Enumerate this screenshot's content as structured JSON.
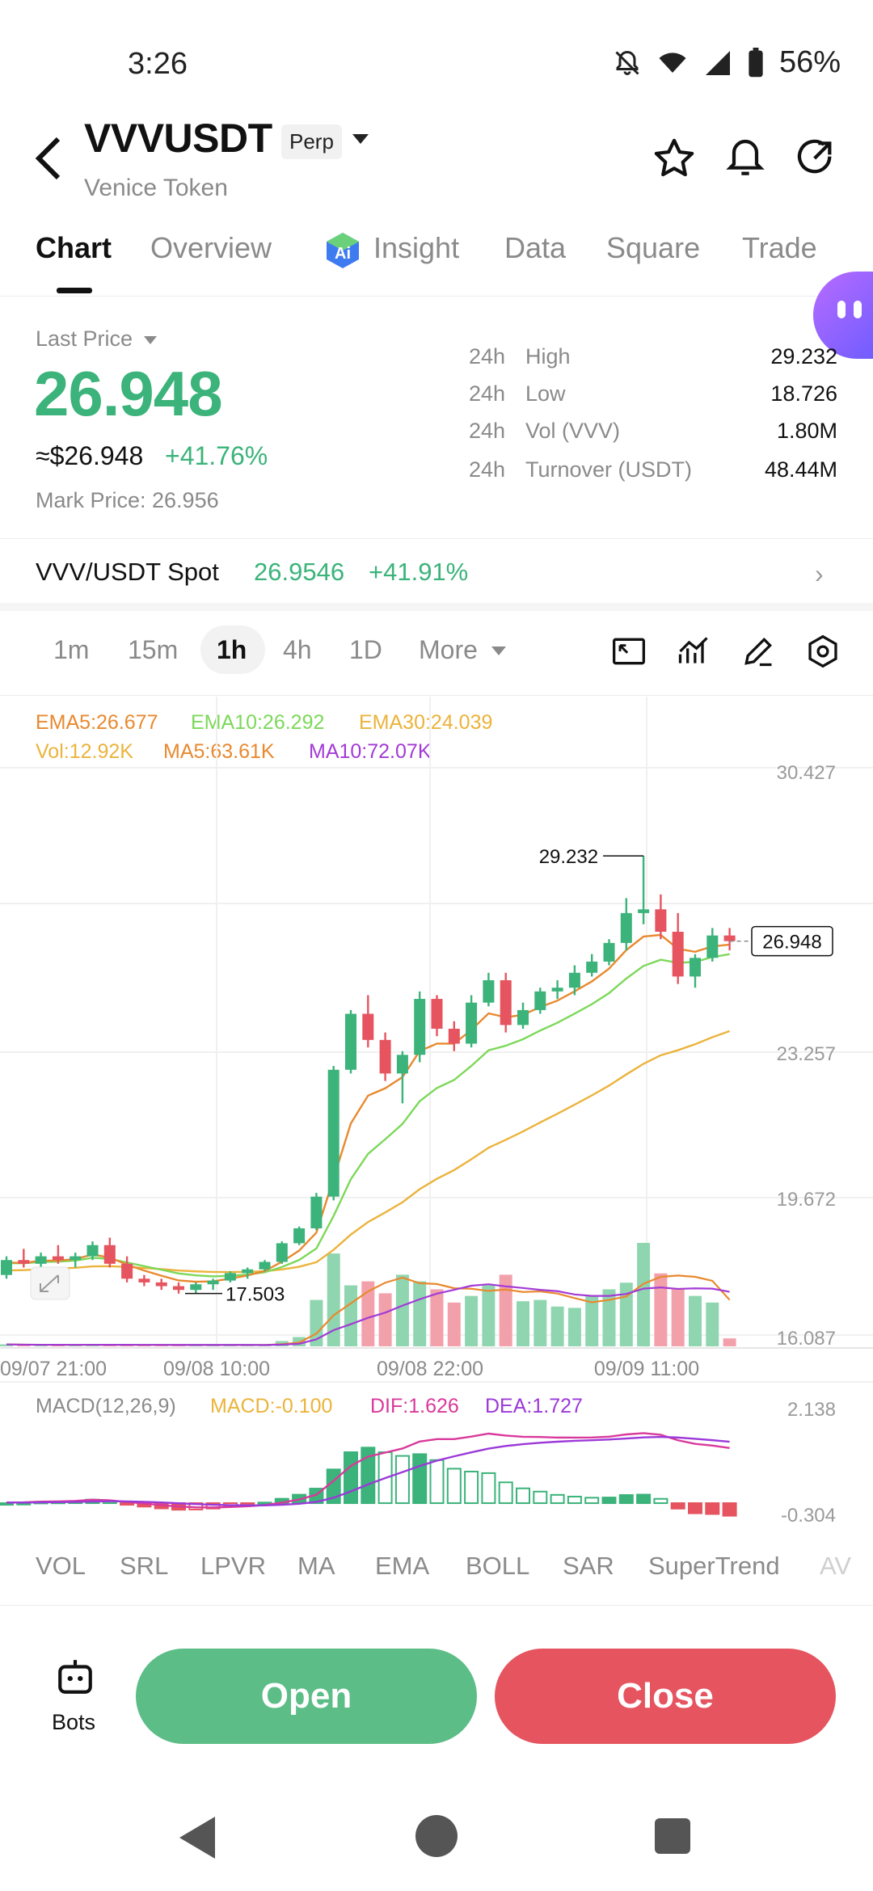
{
  "status": {
    "time": "3:26",
    "battery": "56%"
  },
  "header": {
    "symbol": "VVVUSDT",
    "badge": "Perp",
    "subtitle": "Venice Token"
  },
  "tabs": [
    "Chart",
    "Overview",
    "Insight",
    "Data",
    "Square",
    "Trade"
  ],
  "price": {
    "last_price_label": "Last Price",
    "last_price": "26.948",
    "usd_price": "≈$26.948",
    "change_pct": "+41.76%",
    "mark_price": "Mark Price: 26.956"
  },
  "stats": [
    {
      "period": "24h",
      "name": "High",
      "value": "29.232"
    },
    {
      "period": "24h",
      "name": "Low",
      "value": "18.726"
    },
    {
      "period": "24h",
      "name": "Vol (VVV)",
      "value": "1.80M"
    },
    {
      "period": "24h",
      "name": "Turnover (USDT)",
      "value": "48.44M"
    }
  ],
  "spot": {
    "label": "VVV/USDT Spot",
    "price": "26.9546",
    "change": "+41.91%"
  },
  "intervals": [
    "1m",
    "15m",
    "1h",
    "4h",
    "1D",
    "More"
  ],
  "legend": {
    "ema5": "EMA5:26.677",
    "ema10": "EMA10:26.292",
    "ema30": "EMA30:24.039",
    "vol": "Vol:12.92K",
    "ma5": "MA5:63.61K",
    "ma10": "MA10:72.07K"
  },
  "macd_legend": {
    "name": "MACD(12,26,9)",
    "macd": "MACD:-0.100",
    "dif": "DIF:1.626",
    "dea": "DEA:1.727"
  },
  "colors": {
    "up": "#3bb37a",
    "down": "#e5545f",
    "ema5": "#e8892f",
    "ema10": "#7cd85a",
    "ema30": "#ebb33b",
    "ma10": "#a33ad6",
    "dif": "#d9399b",
    "dea": "#9b39d9"
  },
  "indicators": [
    "VOL",
    "SRL",
    "LPVR",
    "MA",
    "EMA",
    "BOLL",
    "SAR",
    "SuperTrend",
    "AV"
  ],
  "actions": {
    "bots": "Bots",
    "open": "Open",
    "close": "Close"
  },
  "chart_data": {
    "type": "candlestick",
    "y_axis_labels": [
      "30.427",
      "23.257",
      "19.672",
      "16.087"
    ],
    "x_axis_labels": [
      "09/07 21:00",
      "09/08 10:00",
      "09/08 22:00",
      "09/09 11:00"
    ],
    "price_axis_ticks": [
      30.427,
      23.257,
      19.672,
      16.087
    ],
    "ylim": [
      16.087,
      30.427
    ],
    "annotations": {
      "high": "29.232",
      "low": "17.503",
      "current": "26.948"
    },
    "candles": [
      [
        18.0,
        18.5,
        17.9,
        18.4
      ],
      [
        18.4,
        18.7,
        18.2,
        18.3
      ],
      [
        18.3,
        18.6,
        18.1,
        18.5
      ],
      [
        18.5,
        18.8,
        18.3,
        18.4
      ],
      [
        18.4,
        18.6,
        18.2,
        18.5
      ],
      [
        18.5,
        18.9,
        18.4,
        18.8
      ],
      [
        18.8,
        19.0,
        18.2,
        18.3
      ],
      [
        18.3,
        18.5,
        17.8,
        17.9
      ],
      [
        17.9,
        18.0,
        17.7,
        17.8
      ],
      [
        17.8,
        17.9,
        17.6,
        17.7
      ],
      [
        17.7,
        17.8,
        17.5,
        17.6
      ],
      [
        17.6,
        17.8,
        17.5,
        17.75
      ],
      [
        17.75,
        17.9,
        17.6,
        17.85
      ],
      [
        17.85,
        18.1,
        17.8,
        18.05
      ],
      [
        18.05,
        18.2,
        17.9,
        18.15
      ],
      [
        18.15,
        18.4,
        18.1,
        18.35
      ],
      [
        18.35,
        18.9,
        18.3,
        18.85
      ],
      [
        18.85,
        19.3,
        18.8,
        19.25
      ],
      [
        19.25,
        20.2,
        19.2,
        20.1
      ],
      [
        20.1,
        23.6,
        20.0,
        23.5
      ],
      [
        23.5,
        25.1,
        23.4,
        25.0
      ],
      [
        25.0,
        25.5,
        24.1,
        24.3
      ],
      [
        24.3,
        24.5,
        23.2,
        23.4
      ],
      [
        23.4,
        24.0,
        22.6,
        23.9
      ],
      [
        23.9,
        25.6,
        23.7,
        25.4
      ],
      [
        25.4,
        25.5,
        24.4,
        24.6
      ],
      [
        24.6,
        24.8,
        24.0,
        24.2
      ],
      [
        24.2,
        25.5,
        24.1,
        25.3
      ],
      [
        25.3,
        26.1,
        25.2,
        25.9
      ],
      [
        25.9,
        26.1,
        24.5,
        24.7
      ],
      [
        24.7,
        25.3,
        24.6,
        25.1
      ],
      [
        25.1,
        25.7,
        25.0,
        25.6
      ],
      [
        25.6,
        25.9,
        25.4,
        25.7
      ],
      [
        25.7,
        26.3,
        25.5,
        26.1
      ],
      [
        26.1,
        26.6,
        26.0,
        26.4
      ],
      [
        26.4,
        27.0,
        26.3,
        26.9
      ],
      [
        26.9,
        28.1,
        26.7,
        27.7
      ],
      [
        27.7,
        29.232,
        27.4,
        27.8
      ],
      [
        27.8,
        28.2,
        27.0,
        27.2
      ],
      [
        27.2,
        27.7,
        25.8,
        26.0
      ],
      [
        26.0,
        26.6,
        25.7,
        26.5
      ],
      [
        26.5,
        27.3,
        26.4,
        27.1
      ],
      [
        27.1,
        27.3,
        26.7,
        26.948
      ]
    ],
    "volume": [
      3,
      2,
      2,
      2,
      2,
      3,
      2,
      2,
      2,
      2,
      2,
      2,
      2,
      2,
      2,
      2,
      8,
      14,
      70,
      140,
      92,
      98,
      80,
      108,
      98,
      86,
      66,
      76,
      92,
      108,
      68,
      70,
      60,
      58,
      76,
      86,
      96,
      156,
      110,
      86,
      76,
      66,
      12
    ],
    "macd_ylim": [
      -0.304,
      2.138
    ],
    "macd_axis_labels": [
      "2.138",
      "-0.304"
    ]
  }
}
